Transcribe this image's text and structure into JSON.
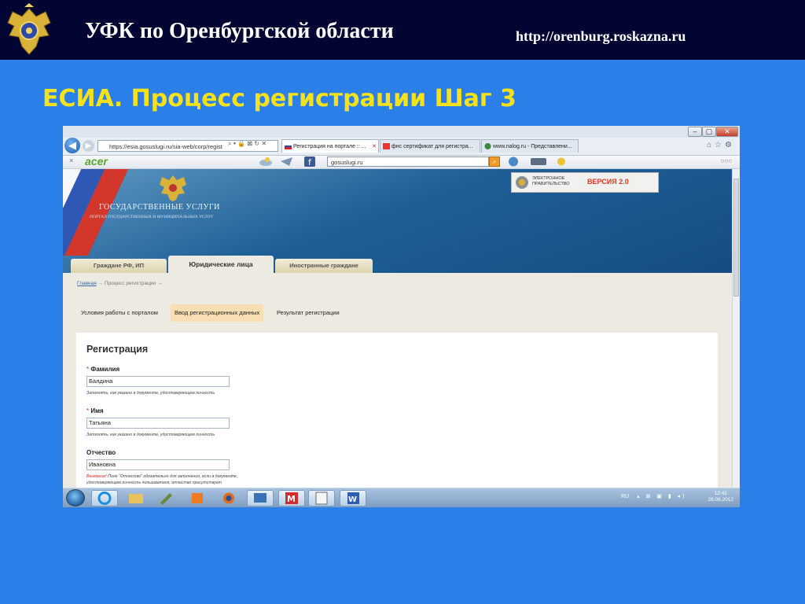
{
  "slide": {
    "org_title": "УФК по Оренбургской области",
    "org_url": "http://orenburg.roskazna.ru",
    "title": "ЕСИА. Процесс регистрации Шаг 3"
  },
  "browser": {
    "address": "https://esia.gosuslugi.ru/sia-web/corp/regist",
    "address_controls": "⌕ ▾ 🔒 ⊠ ↻ ✕",
    "tabs": [
      {
        "label": "Регистрация на портале :: ...",
        "close": "✕",
        "active": true
      },
      {
        "label": "фнс сертификат для регистра...",
        "active": false
      },
      {
        "label": "www.nalog.ru - Представлени...",
        "active": false
      }
    ],
    "toolbar": {
      "close": "×",
      "brand": "acer",
      "search_value": "gosuslugi.ru",
      "more": "○○○"
    },
    "window_controls": [
      "–",
      "▢",
      "✕"
    ]
  },
  "portal": {
    "name": "ГОСУДАРСТВЕННЫЕ УСЛУГИ",
    "subtitle": "ПОРТАЛ ГОСУДАРСТВЕННЫХ И МУНИЦИПАЛЬНЫХ УСЛУГ",
    "egov_label": "ЭЛЕКТРОННОЕ\nПРАВИТЕЛЬСТВО",
    "egov_version": "ВЕРСИЯ 2.0",
    "tabs": [
      "Граждане РФ, ИП",
      "Юридические лица",
      "Иностранные граждане"
    ],
    "active_tab": 1,
    "breadcrumb": {
      "home": "Главная",
      "sep": "→",
      "current": "Процесс регистрации",
      "tail": "→"
    },
    "steps": [
      "Условия работы с порталом",
      "Ввод регистрационных данных",
      "Результат регистрации"
    ],
    "active_step": 1,
    "form": {
      "title": "Регистрация",
      "required_mark": "*",
      "fields": [
        {
          "label": "Фамилия",
          "value": "Балдина",
          "hint": "Заполнять, как указано в документе, удостоверяющем личность"
        },
        {
          "label": "Имя",
          "value": "Татьяна",
          "hint": "Заполнять, как указано в документе, удостоверяющем личность"
        },
        {
          "label": "Отчество",
          "value": "Ивановна",
          "hint_warn": "Внимание!",
          "hint": " Поле \"Отчество\" обязательно для заполнения, если в документе,",
          "hint2": "удостоверяющем личность пользователя, отчество присутствует"
        }
      ]
    }
  },
  "taskbar": {
    "lang": "RU",
    "tray_icons": "▴ ⊠ ▣ ▮ ◂)",
    "time": "12:41",
    "date": "26.06.2012"
  },
  "colors": {
    "slide_bg": "#2a7fe8",
    "header_bg": "#020531",
    "title_yellow": "#f7e21a",
    "egov_version": "#d73a1f",
    "active_step": "#f8dfb3"
  }
}
